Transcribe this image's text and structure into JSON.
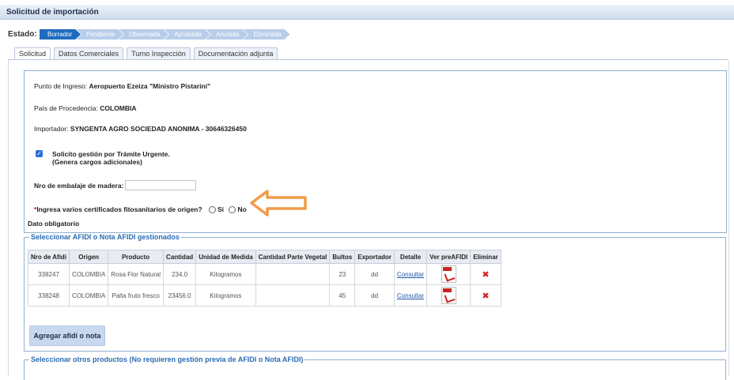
{
  "window": {
    "title": "Solicitud de importación"
  },
  "estado": {
    "label": "Estado:",
    "steps": [
      "Borrador",
      "Pendiente",
      "Observada",
      "Aprobada",
      "Anulada",
      "Eliminada"
    ],
    "active": "Borrador"
  },
  "tabs": [
    "Solicitud",
    "Datos Comerciales",
    "Turno Inspección",
    "Documentación adjunta"
  ],
  "form": {
    "punto_ingreso_label": "Punto de Ingreso:",
    "punto_ingreso_value": "Aeropuerto Ezeiza \"Ministro Pistarini\"",
    "pais_label": "País de Procedencia:",
    "pais_value": "COLOMBIA",
    "importador_label": "Importador:",
    "importador_value": "SYNGENTA AGRO SOCIEDAD ANONIMA - 30646326450",
    "urgente_line1": "Solicito gestión por Trámite Urgente.",
    "urgente_line2": "(Genera cargos adicionales)",
    "urgente_checked": true,
    "embalaje_label": "Nro de embalaje de madera:",
    "embalaje_value": "",
    "certificados_question": "Ingresa varios certificados fitosanitarios de origen?",
    "option_si": "Si",
    "option_no": "No",
    "required_msg": "Dato obligatorio"
  },
  "afidi_section": {
    "legend": "Seleccionar AFIDI o Nota AFIDI gestionados",
    "columns": [
      "Nro de Afidi",
      "Origen",
      "Producto",
      "Cantidad",
      "Unidad de Medida",
      "Cantidad Parte Vegetal",
      "Bultos",
      "Exportador",
      "Detalle",
      "Ver preAFIDI",
      "Eliminar"
    ],
    "rows": [
      {
        "nro": "338247",
        "origen": "COLOMBIA",
        "producto": "Rosa Flor Natural",
        "cantidad": "234.0",
        "unidad": "Kilogramos",
        "parte_vegetal": "",
        "bultos": "23",
        "exportador": "dd",
        "detalle": "Consultar"
      },
      {
        "nro": "338248",
        "origen": "COLOMBIA",
        "producto": "Palta fruto fresco",
        "cantidad": "23456.0",
        "unidad": "Kilogramos",
        "parte_vegetal": "",
        "bultos": "45",
        "exportador": "dd",
        "detalle": "Consultar"
      }
    ],
    "add_button": "Agregar afidi o nota"
  },
  "otros_section": {
    "legend": "Seleccionar otros productos (No requieren gestión previa de AFIDI o Nota AFIDI)"
  },
  "colors": {
    "accent": "#1f6bc0",
    "arrow": "#f29b4a",
    "delete": "#d21f1f"
  }
}
